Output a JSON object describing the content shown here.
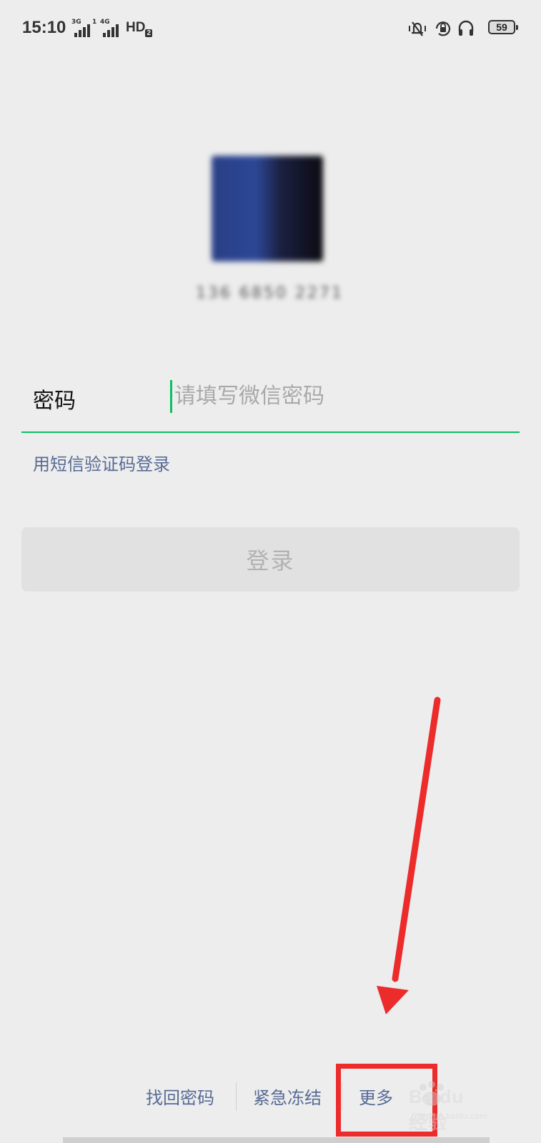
{
  "status_bar": {
    "time": "15:10",
    "net1": "3G",
    "net2": "1",
    "net3": "4G",
    "hd": "HD",
    "hd_sub": "2",
    "battery": "59",
    "icons": [
      "vibrate-icon",
      "rotation-lock-icon",
      "headset-icon",
      "battery-icon"
    ]
  },
  "profile": {
    "account_blurred": "136 6850 2271"
  },
  "password": {
    "label": "密码",
    "placeholder": "请填写微信密码"
  },
  "sms_login_link": "用短信验证码登录",
  "login_button": "登录",
  "bottom_links": {
    "find_password": "找回密码",
    "emergency_freeze": "紧急冻结",
    "more": "更多"
  },
  "watermark": {
    "text": "Baidu经验",
    "url": "jingyan.baidu.com"
  },
  "colors": {
    "accent_green": "#07c160",
    "link_blue": "#576b95",
    "annotation_red": "#ec2b2b",
    "background": "#ededed"
  }
}
